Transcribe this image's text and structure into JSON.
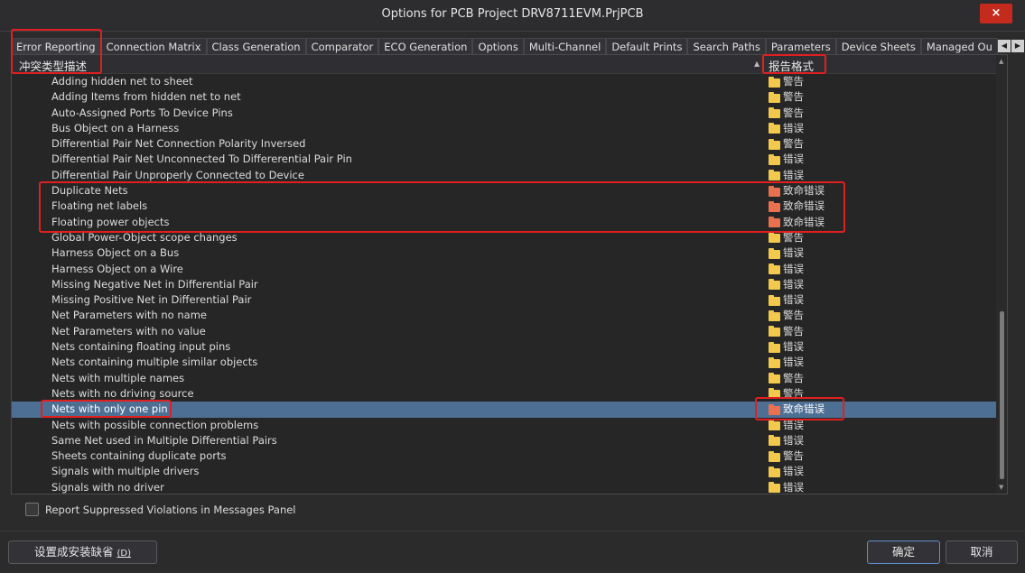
{
  "window": {
    "title": "Options for PCB Project DRV8711EVM.PrjPCB",
    "close_label": "×"
  },
  "tabs": [
    {
      "label": "Error Reporting",
      "active": true
    },
    {
      "label": "Connection Matrix"
    },
    {
      "label": "Class Generation"
    },
    {
      "label": "Comparator"
    },
    {
      "label": "ECO Generation"
    },
    {
      "label": "Options"
    },
    {
      "label": "Multi-Channel"
    },
    {
      "label": "Default Prints"
    },
    {
      "label": "Search Paths"
    },
    {
      "label": "Parameters"
    },
    {
      "label": "Device Sheets"
    },
    {
      "label": "Managed Ou"
    }
  ],
  "tab_scroll": {
    "left": "◀",
    "right": "▶"
  },
  "table": {
    "col_desc": "冲突类型描述",
    "col_format": "报告格式",
    "sort_glyph": "▲",
    "rows": [
      {
        "desc": "Adding hidden net to sheet",
        "format": "警告",
        "level": "warning"
      },
      {
        "desc": "Adding Items from hidden net to net",
        "format": "警告",
        "level": "warning"
      },
      {
        "desc": "Auto-Assigned Ports To Device Pins",
        "format": "警告",
        "level": "warning"
      },
      {
        "desc": "Bus Object on a Harness",
        "format": "错误",
        "level": "error"
      },
      {
        "desc": "Differential Pair Net Connection Polarity Inversed",
        "format": "警告",
        "level": "warning"
      },
      {
        "desc": "Differential Pair Net Unconnected To Differerential Pair Pin",
        "format": "错误",
        "level": "error"
      },
      {
        "desc": "Differential Pair Unproperly Connected to Device",
        "format": "错误",
        "level": "error"
      },
      {
        "desc": "Duplicate Nets",
        "format": "致命错误",
        "level": "fatal"
      },
      {
        "desc": "Floating net labels",
        "format": "致命错误",
        "level": "fatal"
      },
      {
        "desc": "Floating power objects",
        "format": "致命错误",
        "level": "fatal"
      },
      {
        "desc": "Global Power-Object scope changes",
        "format": "警告",
        "level": "warning"
      },
      {
        "desc": "Harness Object on a Bus",
        "format": "错误",
        "level": "error"
      },
      {
        "desc": "Harness Object on a Wire",
        "format": "错误",
        "level": "error"
      },
      {
        "desc": "Missing Negative Net in Differential Pair",
        "format": "错误",
        "level": "error"
      },
      {
        "desc": "Missing Positive Net in Differential Pair",
        "format": "错误",
        "level": "error"
      },
      {
        "desc": "Net Parameters with no name",
        "format": "警告",
        "level": "warning"
      },
      {
        "desc": "Net Parameters with no value",
        "format": "警告",
        "level": "warning"
      },
      {
        "desc": "Nets containing floating input pins",
        "format": "错误",
        "level": "error"
      },
      {
        "desc": "Nets containing multiple similar objects",
        "format": "错误",
        "level": "error"
      },
      {
        "desc": "Nets with multiple names",
        "format": "警告",
        "level": "warning"
      },
      {
        "desc": "Nets with no driving source",
        "format": "警告",
        "level": "warning"
      },
      {
        "desc": "Nets with only one pin",
        "format": "致命错误",
        "level": "fatal",
        "selected": true
      },
      {
        "desc": "Nets with possible connection problems",
        "format": "错误",
        "level": "error"
      },
      {
        "desc": "Same Net used in Multiple Differential Pairs",
        "format": "错误",
        "level": "error"
      },
      {
        "desc": "Sheets containing duplicate ports",
        "format": "警告",
        "level": "warning"
      },
      {
        "desc": "Signals with multiple drivers",
        "format": "错误",
        "level": "error"
      },
      {
        "desc": "Signals with no driver",
        "format": "错误",
        "level": "error"
      }
    ]
  },
  "scroll": {
    "up": "▲",
    "down": "▼"
  },
  "options": {
    "report_suppressed_label": "Report Suppressed Violations in Messages Panel",
    "report_suppressed_checked": false
  },
  "buttons": {
    "set_default_label": "设置成安装缺省",
    "set_default_shortcut": "(D)",
    "ok_label": "确定",
    "cancel_label": "取消"
  },
  "colors": {
    "highlight_red": "#e02020",
    "selected_row": "#4e6f94",
    "folder_warning_error": "#f2c94c",
    "folder_fatal": "#e9714f"
  }
}
